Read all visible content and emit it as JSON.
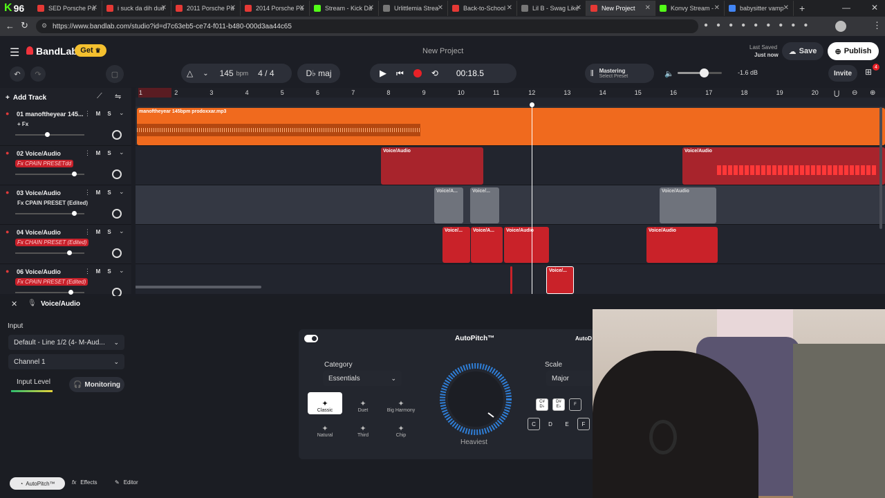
{
  "browser": {
    "tabs": [
      {
        "title": "SED Porsche Pa",
        "color": "#e53935"
      },
      {
        "title": "i suck da dih dud",
        "color": "#e53935"
      },
      {
        "title": "2011 Porsche Pa",
        "color": "#e53935"
      },
      {
        "title": "2014 Porsche Pa",
        "color": "#e53935"
      },
      {
        "title": "Stream - Kick Da",
        "color": "#53fc18"
      },
      {
        "title": "Urlittlemia Strea",
        "color": "#777777"
      },
      {
        "title": "Back-to-School",
        "color": "#e53935"
      },
      {
        "title": "Lil B - Swag Like",
        "color": "#777777"
      },
      {
        "title": "New Project",
        "color": "#e53935"
      },
      {
        "title": "Konvy Stream - ",
        "color": "#53fc18"
      },
      {
        "title": "babysitter vamp",
        "color": "#4285f4"
      }
    ],
    "kick_badge": "96",
    "url": "https://www.bandlab.com/studio?id=d7c63eb5-ce74-f011-b480-000d3aa44c65"
  },
  "header": {
    "logo": "BandLab",
    "get_label": "Get",
    "project_title": "New Project",
    "last_saved_label": "Last Saved",
    "last_saved_value": "Just now",
    "save_label": "Save",
    "publish_label": "Publish",
    "invite_label": "Invite",
    "notif_count": "4"
  },
  "transport": {
    "bpm": "145",
    "bpm_unit": "bpm",
    "time_sig": "4 / 4",
    "key": "D♭ maj",
    "time": "00:18.5",
    "mastering_title": "Mastering",
    "mastering_sub": "Select Preset",
    "volume_db": "-1.6 dB",
    "volume_level": 0.6
  },
  "tracks_toolbar": {
    "add_track_label": "Add Track"
  },
  "ruler": [
    "1",
    "2",
    "3",
    "4",
    "5",
    "6",
    "7",
    "8",
    "9",
    "10",
    "11",
    "12",
    "13",
    "14",
    "15",
    "16",
    "17",
    "18",
    "19",
    "20"
  ],
  "tracks": [
    {
      "name": "01  manoftheyear 145...",
      "fx": "+ Fx",
      "fx_style": "plain",
      "vol": 0.45
    },
    {
      "name": "02  Voice/Audio",
      "fx": "Fx CPAIN PRESETdd",
      "fx_style": "red",
      "vol": 0.85
    },
    {
      "name": "03  Voice/Audio",
      "fx": "Fx CPAIN PRESET (Edited)",
      "fx_style": "plain",
      "vol": 0.85
    },
    {
      "name": "04  Voice/Audio",
      "fx": "Fx CHAIN PRESET (Edited)",
      "fx_style": "red",
      "vol": 0.78
    },
    {
      "name": "06  Voice/Audio",
      "fx": "Fx CPAIN PRESET (Edited)",
      "fx_style": "red",
      "vol": 0.8
    }
  ],
  "clips": {
    "beat_label": "manoftheyear 145bpm prodoxxar.mp3",
    "voice_label": "Voice/Audio",
    "voice_short": "Voice/A...",
    "voice_short2": "Voice/..."
  },
  "bottom_panel": {
    "track_title": "Voice/Audio",
    "input_label": "Input",
    "input_device": "Default - Line 1/2 (4- M-Aud...",
    "channel": "Channel 1",
    "input_level_label": "Input Level",
    "monitoring_label": "Monitoring",
    "autopitch_title": "AutoPitch™",
    "autopitch_right": "AutoD",
    "category_label": "Category",
    "category_value": "Essentials",
    "modes": [
      "Classic",
      "Duet",
      "Big Harmony",
      "Natural",
      "Third",
      "Chip"
    ],
    "knob_label": "Heaviest",
    "scale_label": "Scale",
    "scale_value": "Major",
    "keys_sharp": [
      "C#\nD♭",
      "D#\nE♭",
      "F"
    ],
    "keys": [
      "C",
      "D",
      "E",
      "F"
    ],
    "tabs": [
      "AutoPitch™",
      "Effects",
      "Editor"
    ]
  }
}
